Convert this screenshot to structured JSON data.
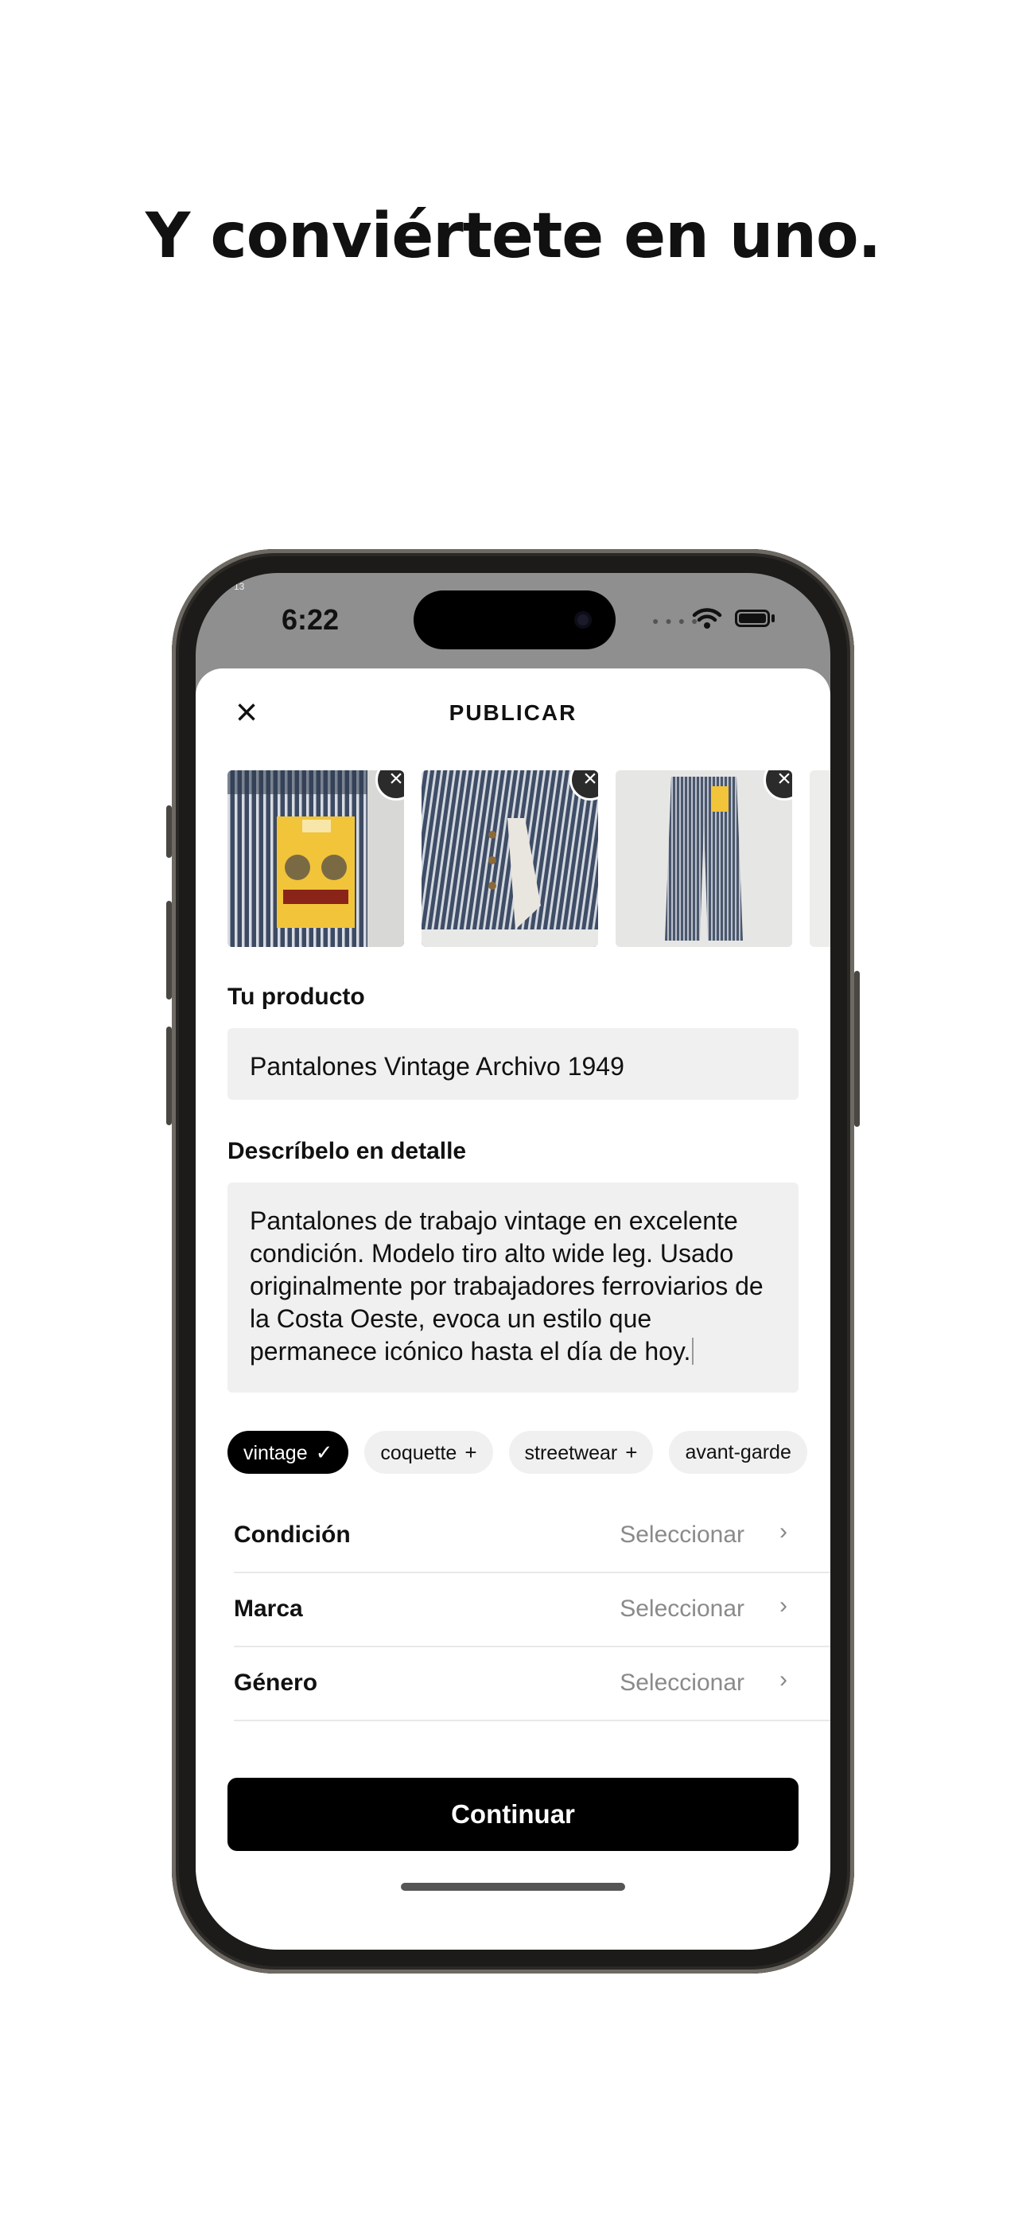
{
  "headline": "Y conviértete en uno.",
  "status_bar": {
    "time": "6:22",
    "corner_text": "13"
  },
  "header": {
    "close_icon": "close-icon",
    "title": "PUBLICAR"
  },
  "photos": [
    {
      "alt": "Lee Dungarees back pocket",
      "remove_icon": "remove-icon"
    },
    {
      "alt": "Button fly detail",
      "remove_icon": "remove-icon"
    },
    {
      "alt": "Full pants back view",
      "remove_icon": "remove-icon"
    }
  ],
  "product": {
    "label": "Tu producto",
    "value": "Pantalones Vintage Archivo 1949"
  },
  "description": {
    "label": "Descríbelo en detalle",
    "value": "Pantalones de trabajo vintage en excelente condición. Modelo tiro alto wide leg. Usado originalmente por trabajadores ferroviarios de la Costa Oeste, evoca un estilo que permanece icónico hasta el día de hoy."
  },
  "tags": [
    {
      "label": "vintage",
      "mark": "✓",
      "selected": true
    },
    {
      "label": "coquette",
      "mark": "+",
      "selected": false
    },
    {
      "label": "streetwear",
      "mark": "+",
      "selected": false
    },
    {
      "label": "avant-garde",
      "mark": "",
      "selected": false
    }
  ],
  "rows": [
    {
      "label": "Condición",
      "value": "Seleccionar"
    },
    {
      "label": "Marca",
      "value": "Seleccionar"
    },
    {
      "label": "Género",
      "value": "Seleccionar"
    }
  ],
  "cta": {
    "label": "Continuar"
  },
  "colors": {
    "accent": "#000000",
    "field_bg": "#f0f0f0",
    "muted_text": "#8a8a8a",
    "status_bar_bg": "#8f8f8f"
  }
}
